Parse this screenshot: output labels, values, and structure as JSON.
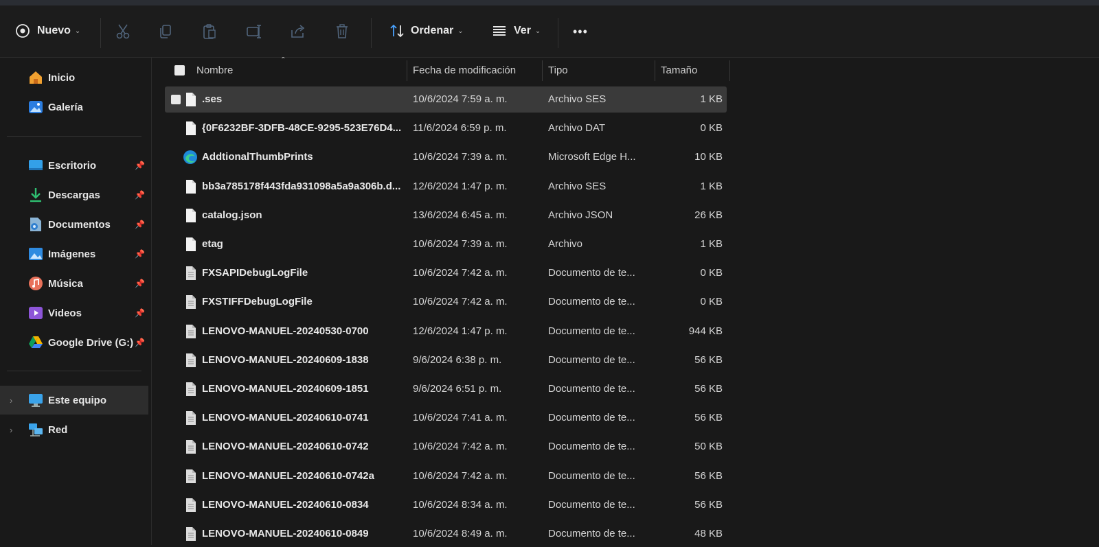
{
  "toolbar": {
    "new_label": "Nuevo",
    "sort_label": "Ordenar",
    "view_label": "Ver",
    "more_label": "•••",
    "icons": [
      "cut-icon",
      "copy-icon",
      "paste-icon",
      "rename-icon",
      "share-icon",
      "delete-icon"
    ]
  },
  "sidebar": {
    "quick": [
      {
        "label": "Inicio",
        "icon": "home-icon"
      },
      {
        "label": "Galería",
        "icon": "gallery-icon"
      }
    ],
    "pinned": [
      {
        "label": "Escritorio",
        "icon": "desktop-icon"
      },
      {
        "label": "Descargas",
        "icon": "download-icon"
      },
      {
        "label": "Documentos",
        "icon": "documents-icon"
      },
      {
        "label": "Imágenes",
        "icon": "pictures-icon"
      },
      {
        "label": "Música",
        "icon": "music-icon"
      },
      {
        "label": "Videos",
        "icon": "videos-icon"
      },
      {
        "label": "Google Drive (G:)",
        "icon": "google-drive-icon"
      }
    ],
    "bottom": [
      {
        "label": "Este equipo",
        "icon": "this-pc-icon"
      },
      {
        "label": "Red",
        "icon": "network-icon"
      }
    ]
  },
  "columns": {
    "name": "Nombre",
    "date": "Fecha de modificación",
    "type": "Tipo",
    "size": "Tamaño"
  },
  "files": [
    {
      "name": ".ses",
      "date": "10/6/2024 7:59 a. m.",
      "type": "Archivo SES",
      "size": "1 KB"
    },
    {
      "name": "{0F6232BF-3DFB-48CE-9295-523E76D4...",
      "date": "11/6/2024 6:59 p. m.",
      "type": "Archivo DAT",
      "size": "0 KB"
    },
    {
      "name": "AddtionalThumbPrints",
      "date": "10/6/2024 7:39 a. m.",
      "type": "Microsoft Edge H...",
      "size": "10 KB"
    },
    {
      "name": "bb3a785178f443fda931098a5a9a306b.d...",
      "date": "12/6/2024 1:47 p. m.",
      "type": "Archivo SES",
      "size": "1 KB"
    },
    {
      "name": "catalog.json",
      "date": "13/6/2024 6:45 a. m.",
      "type": "Archivo JSON",
      "size": "26 KB"
    },
    {
      "name": "etag",
      "date": "10/6/2024 7:39 a. m.",
      "type": "Archivo",
      "size": "1 KB"
    },
    {
      "name": "FXSAPIDebugLogFile",
      "date": "10/6/2024 7:42 a. m.",
      "type": "Documento de te...",
      "size": "0 KB"
    },
    {
      "name": "FXSTIFFDebugLogFile",
      "date": "10/6/2024 7:42 a. m.",
      "type": "Documento de te...",
      "size": "0 KB"
    },
    {
      "name": "LENOVO-MANUEL-20240530-0700",
      "date": "12/6/2024 1:47 p. m.",
      "type": "Documento de te...",
      "size": "944 KB"
    },
    {
      "name": "LENOVO-MANUEL-20240609-1838",
      "date": "9/6/2024 6:38 p. m.",
      "type": "Documento de te...",
      "size": "56 KB"
    },
    {
      "name": "LENOVO-MANUEL-20240609-1851",
      "date": "9/6/2024 6:51 p. m.",
      "type": "Documento de te...",
      "size": "56 KB"
    },
    {
      "name": "LENOVO-MANUEL-20240610-0741",
      "date": "10/6/2024 7:41 a. m.",
      "type": "Documento de te...",
      "size": "56 KB"
    },
    {
      "name": "LENOVO-MANUEL-20240610-0742",
      "date": "10/6/2024 7:42 a. m.",
      "type": "Documento de te...",
      "size": "50 KB"
    },
    {
      "name": "LENOVO-MANUEL-20240610-0742a",
      "date": "10/6/2024 7:42 a. m.",
      "type": "Documento de te...",
      "size": "56 KB"
    },
    {
      "name": "LENOVO-MANUEL-20240610-0834",
      "date": "10/6/2024 8:34 a. m.",
      "type": "Documento de te...",
      "size": "56 KB"
    },
    {
      "name": "LENOVO-MANUEL-20240610-0849",
      "date": "10/6/2024 8:49 a. m.",
      "type": "Documento de te...",
      "size": "48 KB"
    }
  ]
}
